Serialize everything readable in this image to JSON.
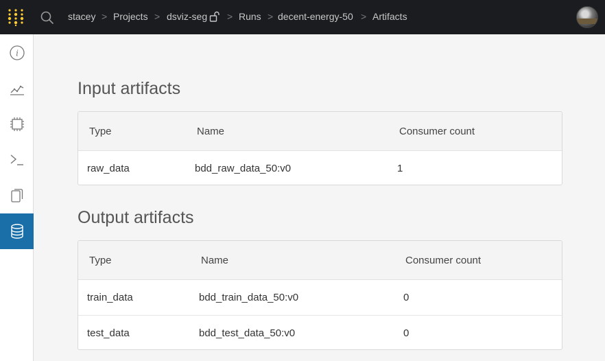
{
  "breadcrumb": {
    "user": "stacey",
    "projects": "Projects",
    "project": "dsviz-seg",
    "runs": "Runs",
    "run": "decent-energy-50",
    "page": "Artifacts",
    "separator": ">"
  },
  "icons": {
    "logo": "wandb-logo-icon",
    "search": "search-icon",
    "lock": "unlock-icon",
    "avatar": "user-avatar"
  },
  "sidebar": {
    "items": [
      {
        "name": "info-icon",
        "active": false
      },
      {
        "name": "chart-icon",
        "active": false
      },
      {
        "name": "chip-icon",
        "active": false
      },
      {
        "name": "terminal-icon",
        "active": false
      },
      {
        "name": "files-icon",
        "active": false
      },
      {
        "name": "database-icon",
        "active": true
      }
    ],
    "active_color": "#1b6fa8"
  },
  "input_artifacts": {
    "title": "Input artifacts",
    "columns": [
      "Type",
      "Name",
      "Consumer count"
    ],
    "rows": [
      {
        "type": "raw_data",
        "name": "bdd_raw_data_50:v0",
        "count": "1"
      }
    ]
  },
  "output_artifacts": {
    "title": "Output artifacts",
    "columns": [
      "Type",
      "Name",
      "Consumer count"
    ],
    "rows": [
      {
        "type": "train_data",
        "name": "bdd_train_data_50:v0",
        "count": "0"
      },
      {
        "type": "test_data",
        "name": "bdd_test_data_50:v0",
        "count": "0"
      }
    ]
  }
}
